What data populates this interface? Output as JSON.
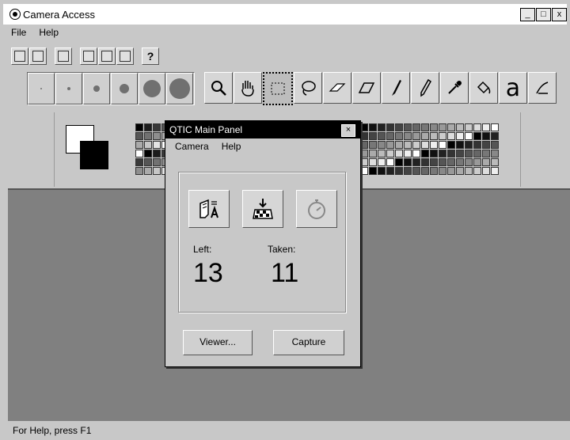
{
  "window": {
    "title": "Camera Access",
    "controls": [
      "_",
      "□",
      "x"
    ]
  },
  "menu": {
    "file": "File",
    "help": "Help"
  },
  "toolbar": {
    "help_glyph": "?"
  },
  "tools": {
    "text_glyph": "a"
  },
  "status": {
    "text": "For Help, press F1"
  },
  "panel": {
    "title": "QTIC  Main Panel",
    "close": "×",
    "menu": {
      "camera": "Camera",
      "help": "Help"
    },
    "left_label": "Left:",
    "left_value": "13",
    "taken_label": "Taken:",
    "taken_value": "11",
    "viewer_button": "Viewer...",
    "capture_button": "Capture"
  },
  "colors": {
    "foreground": "#000000",
    "background": "#ffffff",
    "canvas": "#808080"
  }
}
